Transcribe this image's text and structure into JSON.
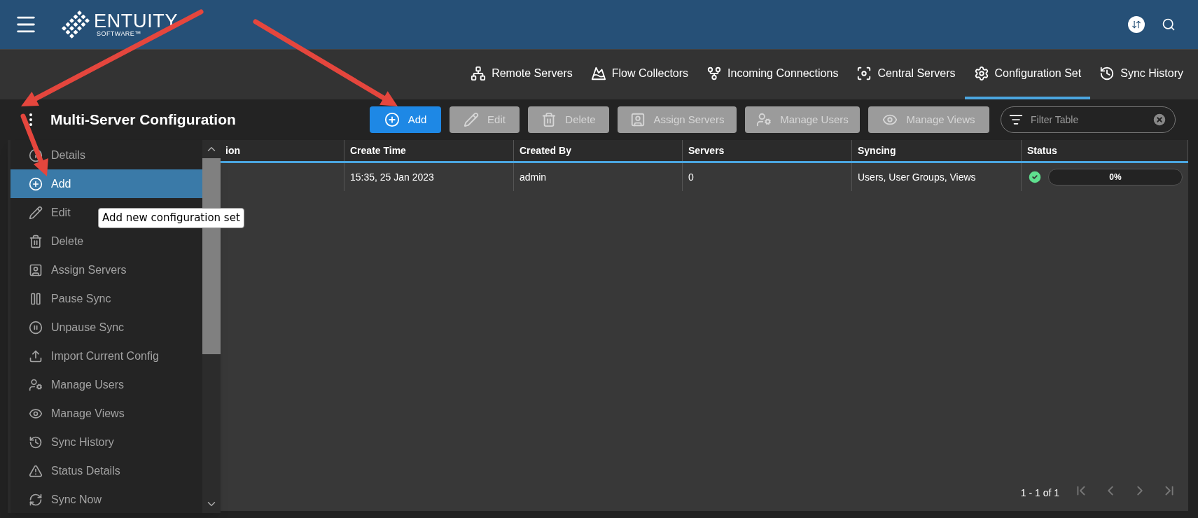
{
  "header": {
    "logo": {
      "name": "ENTUITY",
      "tagline": "SOFTWARE™"
    }
  },
  "tabs": [
    {
      "label": "Remote Servers",
      "selected": false
    },
    {
      "label": "Flow Collectors",
      "selected": false
    },
    {
      "label": "Incoming Connections",
      "selected": false
    },
    {
      "label": "Central Servers",
      "selected": false
    },
    {
      "label": "Configuration Set",
      "selected": true
    },
    {
      "label": "Sync History",
      "selected": false
    }
  ],
  "page_title": "Multi-Server Configuration",
  "toolbar": [
    {
      "label": "Add",
      "disabled": false
    },
    {
      "label": "Edit",
      "disabled": true
    },
    {
      "label": "Delete",
      "disabled": true
    },
    {
      "label": "Assign Servers",
      "disabled": true
    },
    {
      "label": "Manage Users",
      "disabled": true
    },
    {
      "label": "Manage Views",
      "disabled": true
    }
  ],
  "filter": {
    "placeholder": "Filter Table"
  },
  "table": {
    "columns": [
      "ion",
      "Create Time",
      "Created By",
      "Servers",
      "Syncing",
      "Status"
    ],
    "rows": [
      {
        "cells": [
          "",
          "15:35, 25 Jan 2023",
          "admin",
          "0",
          "Users, User Groups, Views"
        ],
        "status": {
          "level": 0,
          "reading": "0%"
        }
      }
    ]
  },
  "pagination": {
    "range": "1 - 1 of 1"
  },
  "menu": {
    "items": [
      {
        "label": "Details",
        "selected": false
      },
      {
        "label": "Add",
        "selected": true
      },
      {
        "label": "Edit",
        "selected": false
      },
      {
        "label": "Delete",
        "selected": false
      },
      {
        "label": "Assign Servers",
        "selected": false
      },
      {
        "label": "Pause Sync",
        "selected": false
      },
      {
        "label": "Unpause Sync",
        "selected": false
      },
      {
        "label": "Import Current Config",
        "selected": false
      },
      {
        "label": "Manage Users",
        "selected": false
      },
      {
        "label": "Manage Views",
        "selected": false
      },
      {
        "label": "Sync History",
        "selected": false
      },
      {
        "label": "Status Details",
        "selected": false
      },
      {
        "label": "Sync Now",
        "selected": false
      }
    ]
  },
  "tooltip": "Add new configuration set"
}
